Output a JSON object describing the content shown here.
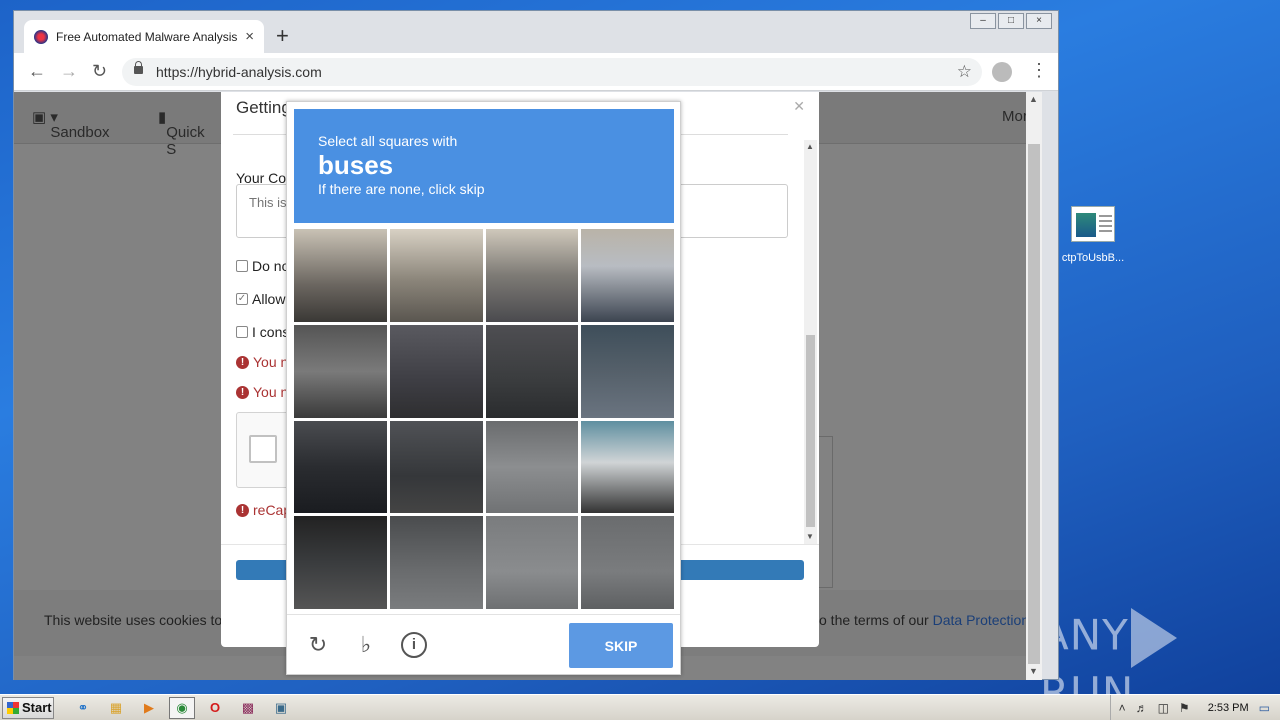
{
  "desktop": {
    "icon_label": "ctpToUsbB...",
    "watermark": {
      "left": "ANY",
      "right": "RUN"
    }
  },
  "browser": {
    "tab_title": "Free Automated Malware Analysis S",
    "new_tab": "+",
    "tab_close": "×",
    "url": "https://hybrid-analysis.com",
    "window_controls": [
      "–",
      "□",
      "×"
    ]
  },
  "site": {
    "nav_sandbox": "Sandbox",
    "nav_quick": "Quick S",
    "nav_more": "More",
    "cookie_left": "This website uses cookies to",
    "cookie_right_prefix": "o the terms of our ",
    "cookie_link": "Data Protection"
  },
  "modal": {
    "title": "Getting Things Read",
    "label_comment": "Your Con",
    "textarea_placeholder": "This is",
    "checkbox_1": "Do no",
    "checkbox_2": "Allow",
    "checkbox_3": "I cons",
    "error_1": "You n",
    "error_2": "You n",
    "error_3": "reCap"
  },
  "captcha": {
    "instruction": "Select all squares with",
    "target": "buses",
    "hint": "If there are none, click skip",
    "skip_label": "SKIP",
    "icons": [
      "reload-icon",
      "audio-icon",
      "info-icon"
    ]
  },
  "taskbar": {
    "start_label": "Start",
    "time": "2:53 PM"
  },
  "colors": {
    "captcha_header": "#4a90e2",
    "skip_button": "#5c99e3",
    "error": "#a33333",
    "submit": "#337ab7"
  }
}
